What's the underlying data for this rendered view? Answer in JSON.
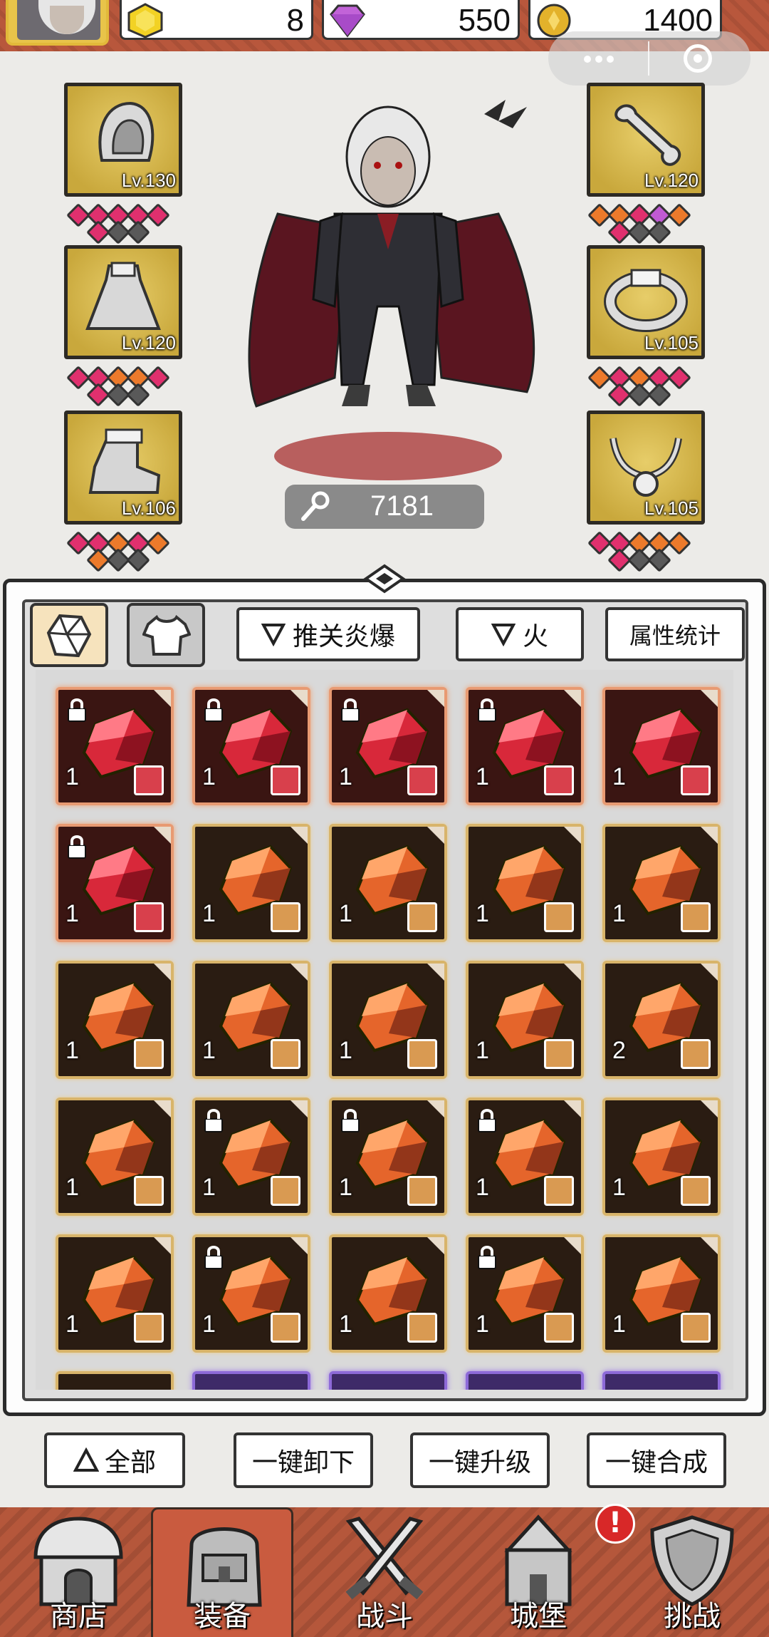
{
  "resources": {
    "crystal": "8",
    "diamond": "550",
    "gold": "1400"
  },
  "equipment_left": [
    {
      "name": "hood",
      "level": "Lv.130",
      "gems": [
        "pink",
        "pink",
        "pink",
        "pink",
        "pink",
        "gray",
        "gray"
      ]
    },
    {
      "name": "cape",
      "level": "Lv.120",
      "gems": [
        "pink",
        "pink",
        "orange",
        "orange",
        "pink",
        "gray",
        "gray"
      ]
    },
    {
      "name": "boots",
      "level": "Lv.106",
      "gems": [
        "pink",
        "pink",
        "orange",
        "pink",
        "orange",
        "gray",
        "gray"
      ]
    }
  ],
  "equipment_right": [
    {
      "name": "weapon",
      "level": "Lv.120",
      "gems": [
        "orange",
        "orange",
        "pink",
        "purple",
        "orange",
        "gray",
        "gray"
      ]
    },
    {
      "name": "ring",
      "level": "Lv.105",
      "gems": [
        "orange",
        "pink",
        "orange",
        "pink",
        "pink",
        "gray",
        "gray"
      ]
    },
    {
      "name": "necklace",
      "level": "Lv.105",
      "gems": [
        "pink",
        "pink",
        "orange",
        "orange",
        "orange",
        "gray",
        "gray"
      ]
    }
  ],
  "hero": {
    "power": "7181"
  },
  "filters": {
    "set_filter": "推关炎爆",
    "element_filter": "火",
    "stats_button": "属性统计"
  },
  "gems_grid": [
    {
      "q": "1",
      "r": "red",
      "lock": true,
      "slot": "necklace"
    },
    {
      "q": "1",
      "r": "red",
      "lock": true,
      "slot": "boots"
    },
    {
      "q": "1",
      "r": "red",
      "lock": true,
      "slot": "weapon"
    },
    {
      "q": "1",
      "r": "red",
      "lock": true,
      "slot": "weapon"
    },
    {
      "q": "1",
      "r": "red",
      "lock": false,
      "slot": "ring"
    },
    {
      "q": "1",
      "r": "red",
      "lock": true,
      "slot": "necklace"
    },
    {
      "q": "1",
      "r": "orange",
      "lock": false,
      "slot": "necklace"
    },
    {
      "q": "1",
      "r": "orange",
      "lock": false,
      "slot": "necklace"
    },
    {
      "q": "1",
      "r": "orange",
      "lock": false,
      "slot": "cape"
    },
    {
      "q": "1",
      "r": "orange",
      "lock": false,
      "slot": "cape"
    },
    {
      "q": "1",
      "r": "orange",
      "lock": false,
      "slot": "cape"
    },
    {
      "q": "1",
      "r": "orange",
      "lock": false,
      "slot": "cape"
    },
    {
      "q": "1",
      "r": "orange",
      "lock": false,
      "slot": "cape"
    },
    {
      "q": "1",
      "r": "orange",
      "lock": false,
      "slot": "boots"
    },
    {
      "q": "2",
      "r": "orange",
      "lock": false,
      "slot": "boots"
    },
    {
      "q": "1",
      "r": "orange",
      "lock": false,
      "slot": "boots"
    },
    {
      "q": "1",
      "r": "orange",
      "lock": true,
      "slot": "weapon"
    },
    {
      "q": "1",
      "r": "orange",
      "lock": true,
      "slot": "weapon"
    },
    {
      "q": "1",
      "r": "orange",
      "lock": true,
      "slot": "ring"
    },
    {
      "q": "1",
      "r": "orange",
      "lock": false,
      "slot": "ring"
    },
    {
      "q": "1",
      "r": "orange",
      "lock": false,
      "slot": "ring"
    },
    {
      "q": "1",
      "r": "orange",
      "lock": true,
      "slot": "ring"
    },
    {
      "q": "1",
      "r": "orange",
      "lock": false,
      "slot": "ring"
    },
    {
      "q": "1",
      "r": "orange",
      "lock": true,
      "slot": "necklace"
    },
    {
      "q": "1",
      "r": "orange",
      "lock": false,
      "slot": "necklace"
    }
  ],
  "actions": {
    "all": "全部",
    "unequip_all": "一键卸下",
    "upgrade_all": "一键升级",
    "merge_all": "一键合成"
  },
  "nav": [
    {
      "label": "商店"
    },
    {
      "label": "装备"
    },
    {
      "label": "战斗"
    },
    {
      "label": "城堡"
    },
    {
      "label": "挑战"
    }
  ],
  "nav_badge": "!"
}
